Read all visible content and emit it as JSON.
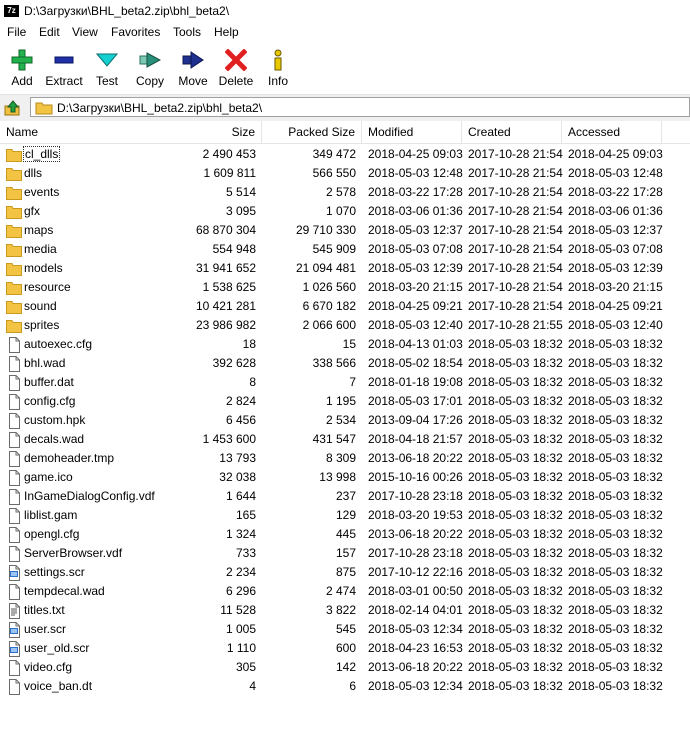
{
  "window": {
    "title": "D:\\Загрузки\\BHL_beta2.zip\\bhl_beta2\\",
    "app_icon_text": "7z"
  },
  "menu": [
    "File",
    "Edit",
    "View",
    "Favorites",
    "Tools",
    "Help"
  ],
  "toolbar": [
    {
      "label": "Add",
      "icon": "plus-icon",
      "color": "#22b14c"
    },
    {
      "label": "Extract",
      "icon": "minus-icon",
      "color": "#1f2fa8"
    },
    {
      "label": "Test",
      "icon": "check-chevron-icon",
      "color": "#14b5b5"
    },
    {
      "label": "Copy",
      "icon": "copy-arrow-icon",
      "color": "#2a8f7a"
    },
    {
      "label": "Move",
      "icon": "move-arrow-icon",
      "color": "#1f2f8f"
    },
    {
      "label": "Delete",
      "icon": "x-icon",
      "color": "#e02020"
    },
    {
      "label": "Info",
      "icon": "info-icon",
      "color": "#e8c800"
    }
  ],
  "address": {
    "path": "D:\\Загрузки\\BHL_beta2.zip\\bhl_beta2\\"
  },
  "columns": [
    "Name",
    "Size",
    "Packed Size",
    "Modified",
    "Created",
    "Accessed"
  ],
  "files": [
    {
      "name": "cl_dlls",
      "type": "folder",
      "size": "2 490 453",
      "packed": "349 472",
      "modified": "2018-04-25 09:03",
      "created": "2017-10-28 21:54",
      "accessed": "2018-04-25 09:03"
    },
    {
      "name": "dlls",
      "type": "folder",
      "size": "1 609 811",
      "packed": "566 550",
      "modified": "2018-05-03 12:48",
      "created": "2017-10-28 21:54",
      "accessed": "2018-05-03 12:48"
    },
    {
      "name": "events",
      "type": "folder",
      "size": "5 514",
      "packed": "2 578",
      "modified": "2018-03-22 17:28",
      "created": "2017-10-28 21:54",
      "accessed": "2018-03-22 17:28"
    },
    {
      "name": "gfx",
      "type": "folder",
      "size": "3 095",
      "packed": "1 070",
      "modified": "2018-03-06 01:36",
      "created": "2017-10-28 21:54",
      "accessed": "2018-03-06 01:36"
    },
    {
      "name": "maps",
      "type": "folder",
      "size": "68 870 304",
      "packed": "29 710 330",
      "modified": "2018-05-03 12:37",
      "created": "2017-10-28 21:54",
      "accessed": "2018-05-03 12:37"
    },
    {
      "name": "media",
      "type": "folder",
      "size": "554 948",
      "packed": "545 909",
      "modified": "2018-05-03 07:08",
      "created": "2017-10-28 21:54",
      "accessed": "2018-05-03 07:08"
    },
    {
      "name": "models",
      "type": "folder",
      "size": "31 941 652",
      "packed": "21 094 481",
      "modified": "2018-05-03 12:39",
      "created": "2017-10-28 21:54",
      "accessed": "2018-05-03 12:39"
    },
    {
      "name": "resource",
      "type": "folder",
      "size": "1 538 625",
      "packed": "1 026 560",
      "modified": "2018-03-20 21:15",
      "created": "2017-10-28 21:54",
      "accessed": "2018-03-20 21:15"
    },
    {
      "name": "sound",
      "type": "folder",
      "size": "10 421 281",
      "packed": "6 670 182",
      "modified": "2018-04-25 09:21",
      "created": "2017-10-28 21:54",
      "accessed": "2018-04-25 09:21"
    },
    {
      "name": "sprites",
      "type": "folder",
      "size": "23 986 982",
      "packed": "2 066 600",
      "modified": "2018-05-03 12:40",
      "created": "2017-10-28 21:55",
      "accessed": "2018-05-03 12:40"
    },
    {
      "name": "autoexec.cfg",
      "type": "file",
      "size": "18",
      "packed": "15",
      "modified": "2018-04-13 01:03",
      "created": "2018-05-03 18:32",
      "accessed": "2018-05-03 18:32"
    },
    {
      "name": "bhl.wad",
      "type": "file",
      "size": "392 628",
      "packed": "338 566",
      "modified": "2018-05-02 18:54",
      "created": "2018-05-03 18:32",
      "accessed": "2018-05-03 18:32"
    },
    {
      "name": "buffer.dat",
      "type": "file",
      "size": "8",
      "packed": "7",
      "modified": "2018-01-18 19:08",
      "created": "2018-05-03 18:32",
      "accessed": "2018-05-03 18:32"
    },
    {
      "name": "config.cfg",
      "type": "file",
      "size": "2 824",
      "packed": "1 195",
      "modified": "2018-05-03 17:01",
      "created": "2018-05-03 18:32",
      "accessed": "2018-05-03 18:32"
    },
    {
      "name": "custom.hpk",
      "type": "file",
      "size": "6 456",
      "packed": "2 534",
      "modified": "2013-09-04 17:26",
      "created": "2018-05-03 18:32",
      "accessed": "2018-05-03 18:32"
    },
    {
      "name": "decals.wad",
      "type": "file",
      "size": "1 453 600",
      "packed": "431 547",
      "modified": "2018-04-18 21:57",
      "created": "2018-05-03 18:32",
      "accessed": "2018-05-03 18:32"
    },
    {
      "name": "demoheader.tmp",
      "type": "file",
      "size": "13 793",
      "packed": "8 309",
      "modified": "2013-06-18 20:22",
      "created": "2018-05-03 18:32",
      "accessed": "2018-05-03 18:32"
    },
    {
      "name": "game.ico",
      "type": "file",
      "size": "32 038",
      "packed": "13 998",
      "modified": "2015-10-16 00:26",
      "created": "2018-05-03 18:32",
      "accessed": "2018-05-03 18:32"
    },
    {
      "name": "InGameDialogConfig.vdf",
      "type": "file",
      "size": "1 644",
      "packed": "237",
      "modified": "2017-10-28 23:18",
      "created": "2018-05-03 18:32",
      "accessed": "2018-05-03 18:32"
    },
    {
      "name": "liblist.gam",
      "type": "file",
      "size": "165",
      "packed": "129",
      "modified": "2018-03-20 19:53",
      "created": "2018-05-03 18:32",
      "accessed": "2018-05-03 18:32"
    },
    {
      "name": "opengl.cfg",
      "type": "file",
      "size": "1 324",
      "packed": "445",
      "modified": "2013-06-18 20:22",
      "created": "2018-05-03 18:32",
      "accessed": "2018-05-03 18:32"
    },
    {
      "name": "ServerBrowser.vdf",
      "type": "file",
      "size": "733",
      "packed": "157",
      "modified": "2017-10-28 23:18",
      "created": "2018-05-03 18:32",
      "accessed": "2018-05-03 18:32"
    },
    {
      "name": "settings.scr",
      "type": "script",
      "size": "2 234",
      "packed": "875",
      "modified": "2017-10-12 22:16",
      "created": "2018-05-03 18:32",
      "accessed": "2018-05-03 18:32"
    },
    {
      "name": "tempdecal.wad",
      "type": "file",
      "size": "6 296",
      "packed": "2 474",
      "modified": "2018-03-01 00:50",
      "created": "2018-05-03 18:32",
      "accessed": "2018-05-03 18:32"
    },
    {
      "name": "titles.txt",
      "type": "text",
      "size": "11 528",
      "packed": "3 822",
      "modified": "2018-02-14 04:01",
      "created": "2018-05-03 18:32",
      "accessed": "2018-05-03 18:32"
    },
    {
      "name": "user.scr",
      "type": "script",
      "size": "1 005",
      "packed": "545",
      "modified": "2018-05-03 12:34",
      "created": "2018-05-03 18:32",
      "accessed": "2018-05-03 18:32"
    },
    {
      "name": "user_old.scr",
      "type": "script",
      "size": "1 110",
      "packed": "600",
      "modified": "2018-04-23 16:53",
      "created": "2018-05-03 18:32",
      "accessed": "2018-05-03 18:32"
    },
    {
      "name": "video.cfg",
      "type": "file",
      "size": "305",
      "packed": "142",
      "modified": "2013-06-18 20:22",
      "created": "2018-05-03 18:32",
      "accessed": "2018-05-03 18:32"
    },
    {
      "name": "voice_ban.dt",
      "type": "file",
      "size": "4",
      "packed": "6",
      "modified": "2018-05-03 12:34",
      "created": "2018-05-03 18:32",
      "accessed": "2018-05-03 18:32"
    }
  ]
}
